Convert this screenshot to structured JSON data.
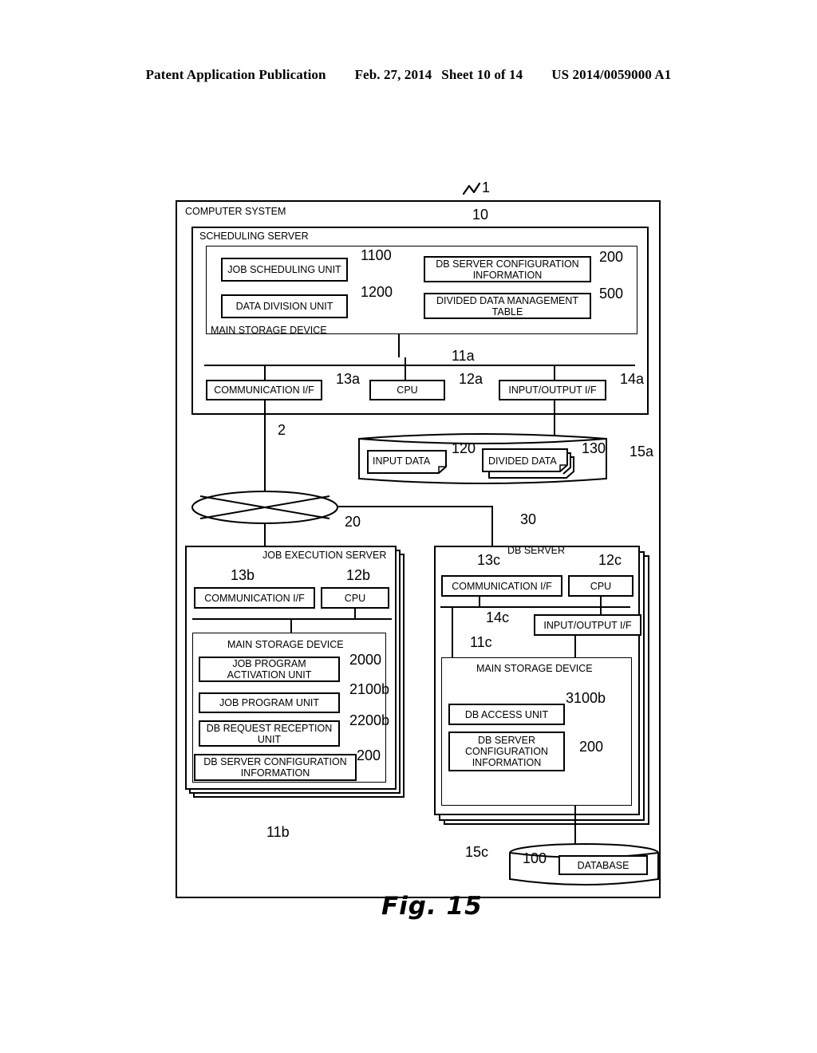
{
  "header": {
    "publication": "Patent Application Publication",
    "date": "Feb. 27, 2014",
    "sheet": "Sheet 10 of 14",
    "number": "US 2014/0059000 A1"
  },
  "figure": {
    "caption": "Fig. 15"
  },
  "diagram": {
    "computer_system": {
      "label": "COMPUTER SYSTEM",
      "ref": "1"
    },
    "scheduling_server": {
      "label": "SCHEDULING SERVER",
      "ref": "10",
      "main_storage_label": "MAIN STORAGE DEVICE",
      "units": [
        {
          "label": "JOB SCHEDULING UNIT",
          "ref": "1100"
        },
        {
          "label": "DATA DIVISION UNIT",
          "ref": "1200"
        },
        {
          "label": "DB SERVER CONFIGURATION INFORMATION",
          "ref": "200"
        },
        {
          "label": "DIVIDED DATA MANAGEMENT TABLE",
          "ref": "500"
        }
      ],
      "bus_ref": "11a",
      "hardware": [
        {
          "label": "COMMUNICATION I/F",
          "ref": "13a"
        },
        {
          "label": "CPU",
          "ref": "12a"
        },
        {
          "label": "INPUT/OUTPUT I/F",
          "ref": "14a"
        }
      ]
    },
    "storage_a": {
      "ref": "15a",
      "items": [
        {
          "label": "INPUT DATA",
          "ref": "120"
        },
        {
          "label": "DIVIDED DATA",
          "ref": "130"
        }
      ]
    },
    "network": {
      "ref": "2"
    },
    "job_execution_server": {
      "label": "JOB EXECUTION SERVER",
      "ref": "20",
      "bus_ref": "11b",
      "hardware": [
        {
          "label": "COMMUNICATION I/F",
          "ref": "13b"
        },
        {
          "label": "CPU",
          "ref": "12b"
        }
      ],
      "main_storage_label": "MAIN STORAGE DEVICE",
      "units": [
        {
          "label": "JOB PROGRAM ACTIVATION UNIT",
          "ref": "2000"
        },
        {
          "label": "JOB PROGRAM UNIT",
          "ref": "2100b"
        },
        {
          "label": "DB REQUEST RECEPTION UNIT",
          "ref": "2200b"
        },
        {
          "label": "DB SERVER CONFIGURATION INFORMATION",
          "ref": "200"
        }
      ]
    },
    "db_server": {
      "label": "DB SERVER",
      "ref": "30",
      "bus_ref": "11c",
      "hardware": [
        {
          "label": "COMMUNICATION I/F",
          "ref": "13c"
        },
        {
          "label": "CPU",
          "ref": "12c"
        },
        {
          "label": "INPUT/OUTPUT I/F",
          "ref": "14c"
        }
      ],
      "main_storage_label": "MAIN STORAGE DEVICE",
      "units": [
        {
          "label": "DB ACCESS UNIT",
          "ref": "3100b"
        },
        {
          "label": "DB SERVER CONFIGURATION INFORMATION",
          "ref": "200"
        }
      ]
    },
    "storage_c": {
      "ref": "15c",
      "database": {
        "label": "DATABASE",
        "ref": "100"
      }
    }
  }
}
